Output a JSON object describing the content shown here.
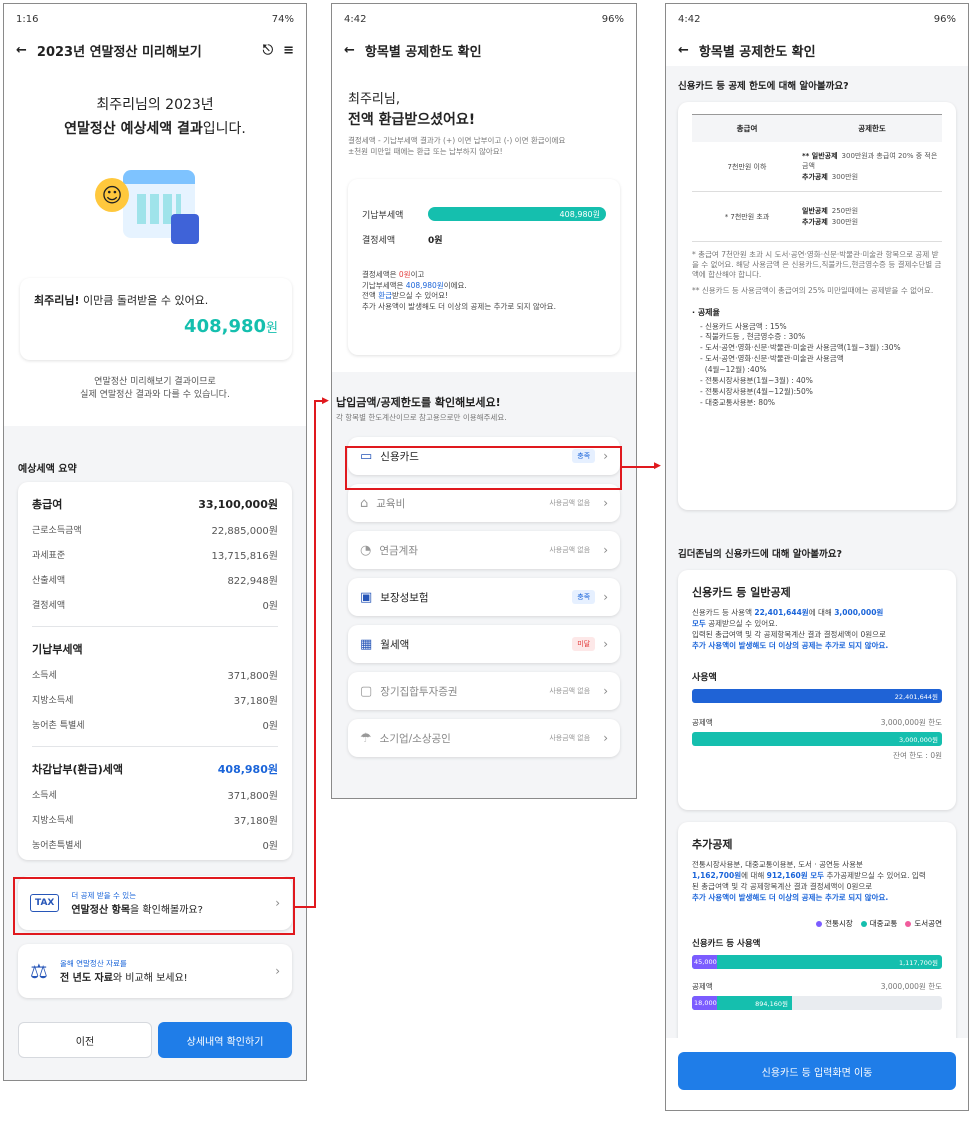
{
  "phone1": {
    "status": {
      "time": "1:16",
      "right": "74%"
    },
    "title": "2023년 연말정산 미리해보기",
    "hero_line1": "최주리님의 2023년",
    "hero_line2_bold": "연말정산 예상세액 결과",
    "hero_line2_rest": "입니다.",
    "refund_card": {
      "name": "최주리님!",
      "text": " 이만큼 돌려받을 수 있어요.",
      "amount": "408,980",
      "unit": "원"
    },
    "notice_line1": "연말정산 미리해보기 결과이므로",
    "notice_line2": "실제 연말정산 결과와 다를 수 있습니다.",
    "summary_title": "예상세액 요약",
    "groups": [
      {
        "head": "총급여",
        "head_value": "33,100,000원",
        "rows": [
          [
            "근로소득금액",
            "22,885,000원"
          ],
          [
            "과세표준",
            "13,715,816원"
          ],
          [
            "산출세액",
            "822,948원"
          ],
          [
            "결정세액",
            "0원"
          ]
        ]
      },
      {
        "head": "기납부세액",
        "head_value": "",
        "rows": [
          [
            "소득세",
            "371,800원"
          ],
          [
            "지방소득세",
            "37,180원"
          ],
          [
            "농어촌 특별세",
            "0원"
          ]
        ]
      },
      {
        "head": "차감납부(환급)세액",
        "head_value": "408,980원",
        "rows": [
          [
            "소득세",
            "371,800원"
          ],
          [
            "지방소득세",
            "37,180원"
          ],
          [
            "농어촌특별세",
            "0원"
          ]
        ]
      }
    ],
    "promo1": {
      "icon_text": "TAX",
      "small": "더 공제 받을 수 있는",
      "bold": "연말정산 항목",
      "rest": "을 확인해볼까요?"
    },
    "promo2": {
      "small": "올해 연말정산 자료를",
      "bold": "전 년도 자료",
      "rest": "와 비교해 보세요!"
    },
    "btn_prev": "이전",
    "btn_detail": "상세내역 확인하기"
  },
  "phone2": {
    "status": {
      "time": "4:42",
      "right": "96%"
    },
    "title": "항목별 공제한도 확인",
    "greet": "최주리님,",
    "headline": "전액 환급받으셨어요!",
    "desc1": "결정세액 - 기납부세액 결과가 (+) 이면 납부이고 (-) 이면 환급이에요",
    "desc2": "±천원 미만일 때에는 환급 또는 납부하지 않아요!",
    "bar_label": "기납부세액",
    "bar_value": "408,980원",
    "bar_fill": 1.0,
    "decided_label": "결정세액",
    "decided_value": "0원",
    "info": [
      [
        "결정세액은 ",
        "0원",
        "이고"
      ],
      [
        "기납부세액은 ",
        "408,980원",
        "이에요."
      ],
      [
        "전액 ",
        "환급",
        "받으실 수 있어요!"
      ],
      [
        "추가 사용액이 발생해도 더 이상의 공제는 추가로 되지 않아요.",
        "",
        ""
      ]
    ],
    "section_title": "납입금액/공제한도를 확인해보세요!",
    "section_sub": "각 항목별 한도계산이므로 참고용으로만 이용해주세요.",
    "menus": [
      {
        "icon": "credit-card-icon",
        "glyph": "▭",
        "label": "신용카드",
        "badge": "충족",
        "badge_type": "ok"
      },
      {
        "icon": "graduation-cap-icon",
        "glyph": "⌂",
        "label": "교육비",
        "badge": "사용금액 없음",
        "badge_type": "no"
      },
      {
        "icon": "pension-icon",
        "glyph": "◔",
        "label": "연금계좌",
        "badge": "사용금액 없음",
        "badge_type": "no"
      },
      {
        "icon": "insurance-icon",
        "glyph": "▣",
        "label": "보장성보험",
        "badge": "충족",
        "badge_type": "ok"
      },
      {
        "icon": "calendar-rent-icon",
        "glyph": "▦",
        "label": "월세액",
        "badge": "미달",
        "badge_type": "under"
      },
      {
        "icon": "savings-icon",
        "glyph": "▢",
        "label": "장기집합투자증권",
        "badge": "사용금액 없음",
        "badge_type": "no"
      },
      {
        "icon": "umbrella-icon",
        "glyph": "☂",
        "label": "소기업/소상공인",
        "badge": "사용금액 없음",
        "badge_type": "no"
      }
    ]
  },
  "phone3": {
    "status": {
      "time": "4:42",
      "right": "96%"
    },
    "title": "항목별 공제한도 확인",
    "q1": "신용카드 등 공제 한도에 대해 알아볼까요?",
    "table_head": [
      "총급여",
      "공제한도"
    ],
    "table_rows": [
      {
        "left": "7천만원 이하",
        "lines": [
          [
            "** 일반공제",
            "300만원과 총급여 20% 중 적은금액"
          ],
          [
            "추가공제",
            "300만원"
          ]
        ]
      },
      {
        "left": "* 7천만원 초과",
        "lines": [
          [
            "일반공제",
            "250만원"
          ],
          [
            "추가공제",
            "300만원"
          ]
        ]
      }
    ],
    "note1": "* 총급여 7천만원 초과 시 도서·공연·영화·신문·박물관·미술관 항목으로 공제 받을 수 없어요. 해당 사용금액 은 신용카드,직불카드,현금영수증 등 결제수단별 금액에 합산해야 합니다.",
    "note2": "** 신용카드 등 사용금액이 총급여의 25% 미만일때에는 공제받을 수 없어요.",
    "rate_title": "· 공제율",
    "rates": [
      "- 신용카드 사용금액 : 15%",
      "- 직불카드등 , 현금영수증 : 30%",
      "- 도서·공연·영화·신문·박물관·미술관 사용금액(1월~3월) :30%",
      "- 도서·공연·영화·신문·박물관·미술관 사용금액",
      "  (4월~12월) :40%",
      "- 전통시장사용분(1월~3월) : 40%",
      "- 전통시장사용분(4월~12월):50%",
      "- 대중교통사용분: 80%"
    ],
    "q2": "김더존님의 신용카드에 대해 알아볼까요?",
    "general": {
      "title": "신용카드 등 일반공제",
      "line1_pre": "신용카드 등 사용액 ",
      "line1_amt": "22,401,644원",
      "line1_mid": "에 대해 ",
      "line1_amt2": "3,000,000원",
      "line2_bold": "모두",
      "line2_rest": " 공제받으실 수 있어요.",
      "line3": "입력된 총급여액 및 각 공제항목계산 결과 결정세액이 0원으로",
      "line4": "추가 사용액이 발생해도 더 이상의 공제는 추가로 되지 않아요.",
      "use_label": "사용액",
      "use_value": "22,401,644원",
      "use_fill": 1.0,
      "ded_label": "공제액",
      "ded_limit": "3,000,000원 한도",
      "ded_value": "3,000,000원",
      "ded_fill": 1.0,
      "remain": "잔여 한도 : 0원"
    },
    "extra": {
      "title": "추가공제",
      "line1": "전통시장사용분, 대중교통이용분, 도서 · 공연등 사용분",
      "line2_amt": "1,162,700원",
      "line2_mid": "에 대해 ",
      "line2_amt2": "912,160원 모두",
      "line2_rest": " 추가공제받으실 수 있어요. 입력",
      "line3": "된 총급여액 및 각 공제항목계산 결과 결정세액이 0원으로",
      "line4": "추가 사용액이 발생해도 더 이상의 공제는 추가로 되지 않아요.",
      "legend": [
        {
          "name": "전통시장",
          "color": "#7b5cff"
        },
        {
          "name": "대중교통",
          "color": "#15bfae"
        },
        {
          "name": "도서공연",
          "color": "#f05c9c"
        }
      ],
      "use_label": "신용카드 등 사용액",
      "use_a": "45,000",
      "use_b": "1,117,700원",
      "use_a_frac": 0.1,
      "ded_label": "공제액",
      "ded_limit": "3,000,000원 한도",
      "ded_a": "18,000",
      "ded_b": "894,160원",
      "ded_a_frac": 0.1,
      "ded_b_frac": 0.3
    },
    "btn": "신용카드 등 입력화면 이동"
  }
}
